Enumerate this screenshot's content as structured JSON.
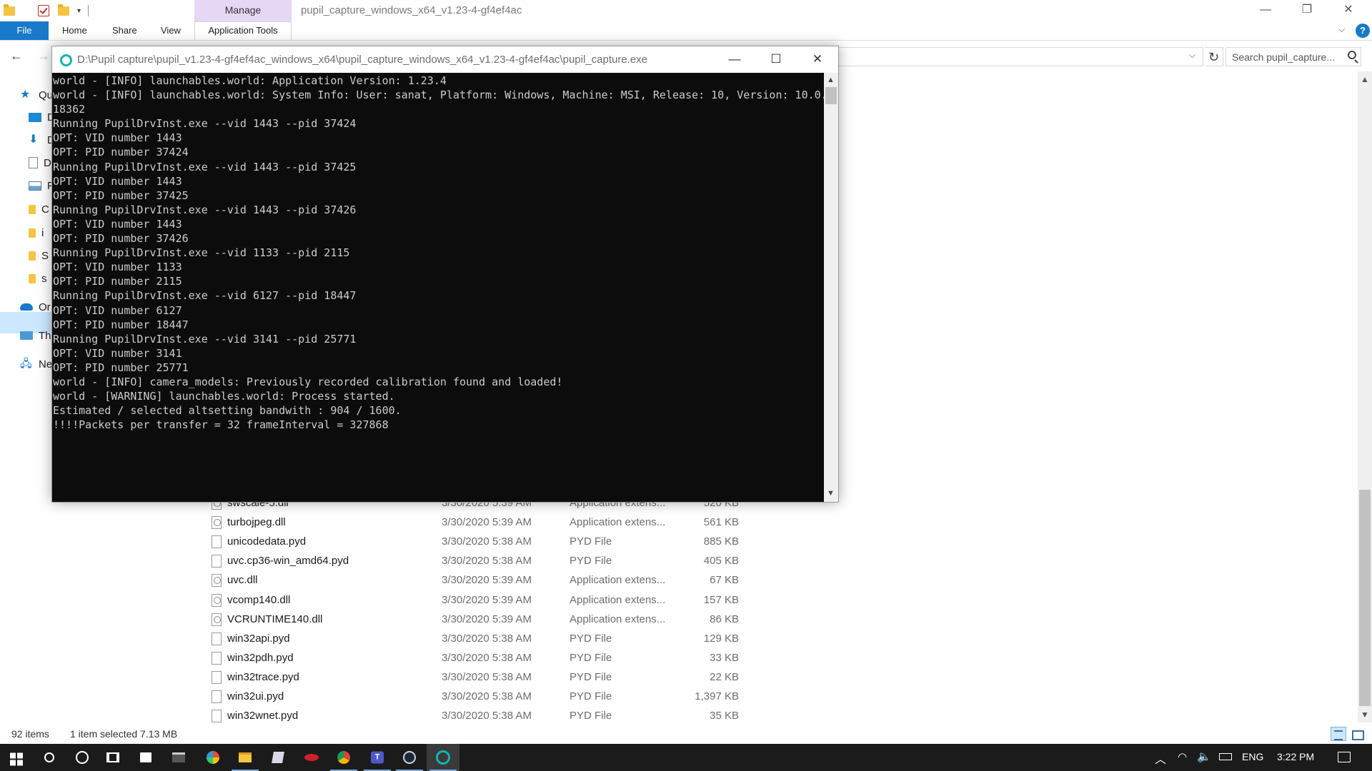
{
  "explorer": {
    "title": "pupil_capture_windows_x64_v1.23-4-gf4ef4ac",
    "manage_tab": "Manage",
    "ribbon": {
      "file": "File",
      "home": "Home",
      "share": "Share",
      "view": "View",
      "application_tools": "Application Tools"
    },
    "search_placeholder": "Search pupil_capture...",
    "nav_pane": [
      {
        "label": "Qu",
        "icon": "star-icon"
      },
      {
        "label": "D",
        "icon": "desktop-icon"
      },
      {
        "label": "D",
        "icon": "download-icon"
      },
      {
        "label": "D",
        "icon": "documents-icon"
      },
      {
        "label": "P",
        "icon": "pictures-icon"
      },
      {
        "label": "C",
        "icon": "folder-icon"
      },
      {
        "label": "i",
        "icon": "folder-icon"
      },
      {
        "label": "S",
        "icon": "folder-icon"
      },
      {
        "label": "s",
        "icon": "folder-icon"
      },
      {
        "label": "Or",
        "icon": "onedrive-icon"
      },
      {
        "label": "Th",
        "icon": "this-pc-icon"
      },
      {
        "label": "Ne",
        "icon": "network-icon"
      }
    ],
    "files": [
      {
        "name": "swscale-5.dll",
        "date": "3/30/2020 5:39 AM",
        "type": "Application extens...",
        "size": "520 KB",
        "icon": "dll"
      },
      {
        "name": "turbojpeg.dll",
        "date": "3/30/2020 5:39 AM",
        "type": "Application extens...",
        "size": "561 KB",
        "icon": "dll"
      },
      {
        "name": "unicodedata.pyd",
        "date": "3/30/2020 5:38 AM",
        "type": "PYD File",
        "size": "885 KB",
        "icon": "file"
      },
      {
        "name": "uvc.cp36-win_amd64.pyd",
        "date": "3/30/2020 5:38 AM",
        "type": "PYD File",
        "size": "405 KB",
        "icon": "file"
      },
      {
        "name": "uvc.dll",
        "date": "3/30/2020 5:39 AM",
        "type": "Application extens...",
        "size": "67 KB",
        "icon": "dll"
      },
      {
        "name": "vcomp140.dll",
        "date": "3/30/2020 5:39 AM",
        "type": "Application extens...",
        "size": "157 KB",
        "icon": "dll"
      },
      {
        "name": "VCRUNTIME140.dll",
        "date": "3/30/2020 5:39 AM",
        "type": "Application extens...",
        "size": "86 KB",
        "icon": "dll"
      },
      {
        "name": "win32api.pyd",
        "date": "3/30/2020 5:38 AM",
        "type": "PYD File",
        "size": "129 KB",
        "icon": "file"
      },
      {
        "name": "win32pdh.pyd",
        "date": "3/30/2020 5:38 AM",
        "type": "PYD File",
        "size": "33 KB",
        "icon": "file"
      },
      {
        "name": "win32trace.pyd",
        "date": "3/30/2020 5:38 AM",
        "type": "PYD File",
        "size": "22 KB",
        "icon": "file"
      },
      {
        "name": "win32ui.pyd",
        "date": "3/30/2020 5:38 AM",
        "type": "PYD File",
        "size": "1,397 KB",
        "icon": "file"
      },
      {
        "name": "win32wnet.pyd",
        "date": "3/30/2020 5:38 AM",
        "type": "PYD File",
        "size": "35 KB",
        "icon": "file"
      }
    ],
    "status": {
      "item_count": "92 items",
      "selection": "1 item selected  7.13 MB"
    }
  },
  "console": {
    "title": "D:\\Pupil capture\\pupil_v1.23-4-gf4ef4ac_windows_x64\\pupil_capture_windows_x64_v1.23-4-gf4ef4ac\\pupil_capture.exe",
    "lines": [
      "world - [INFO] launchables.world: Application Version: 1.23.4",
      "world - [INFO] launchables.world: System Info: User: sanat, Platform: Windows, Machine: MSI, Release: 10, Version: 10.0.",
      "18362",
      "Running PupilDrvInst.exe --vid 1443 --pid 37424",
      "OPT: VID number 1443",
      "OPT: PID number 37424",
      "Running PupilDrvInst.exe --vid 1443 --pid 37425",
      "OPT: VID number 1443",
      "OPT: PID number 37425",
      "Running PupilDrvInst.exe --vid 1443 --pid 37426",
      "OPT: VID number 1443",
      "OPT: PID number 37426",
      "Running PupilDrvInst.exe --vid 1133 --pid 2115",
      "OPT: VID number 1133",
      "OPT: PID number 2115",
      "Running PupilDrvInst.exe --vid 6127 --pid 18447",
      "OPT: VID number 6127",
      "OPT: PID number 18447",
      "Running PupilDrvInst.exe --vid 3141 --pid 25771",
      "OPT: VID number 3141",
      "OPT: PID number 25771",
      "world - [INFO] camera_models: Previously recorded calibration found and loaded!",
      "world - [WARNING] launchables.world: Process started.",
      "Estimated / selected altsetting bandwith : 904 / 1600.",
      "!!!!Packets per transfer = 32 frameInterval = 327868"
    ]
  },
  "taskbar": {
    "apps": [
      "start-icon",
      "search-icon",
      "cortana-icon",
      "task-view-icon",
      "store-icon",
      "terminal-icon",
      "pinwheel-app-icon",
      "file-explorer-icon",
      "notes-icon",
      "game-app-icon",
      "chrome-icon",
      "teams-icon",
      "steam-icon",
      "pupil-capture-icon"
    ],
    "language": "ENG",
    "time": "3:22 PM"
  }
}
